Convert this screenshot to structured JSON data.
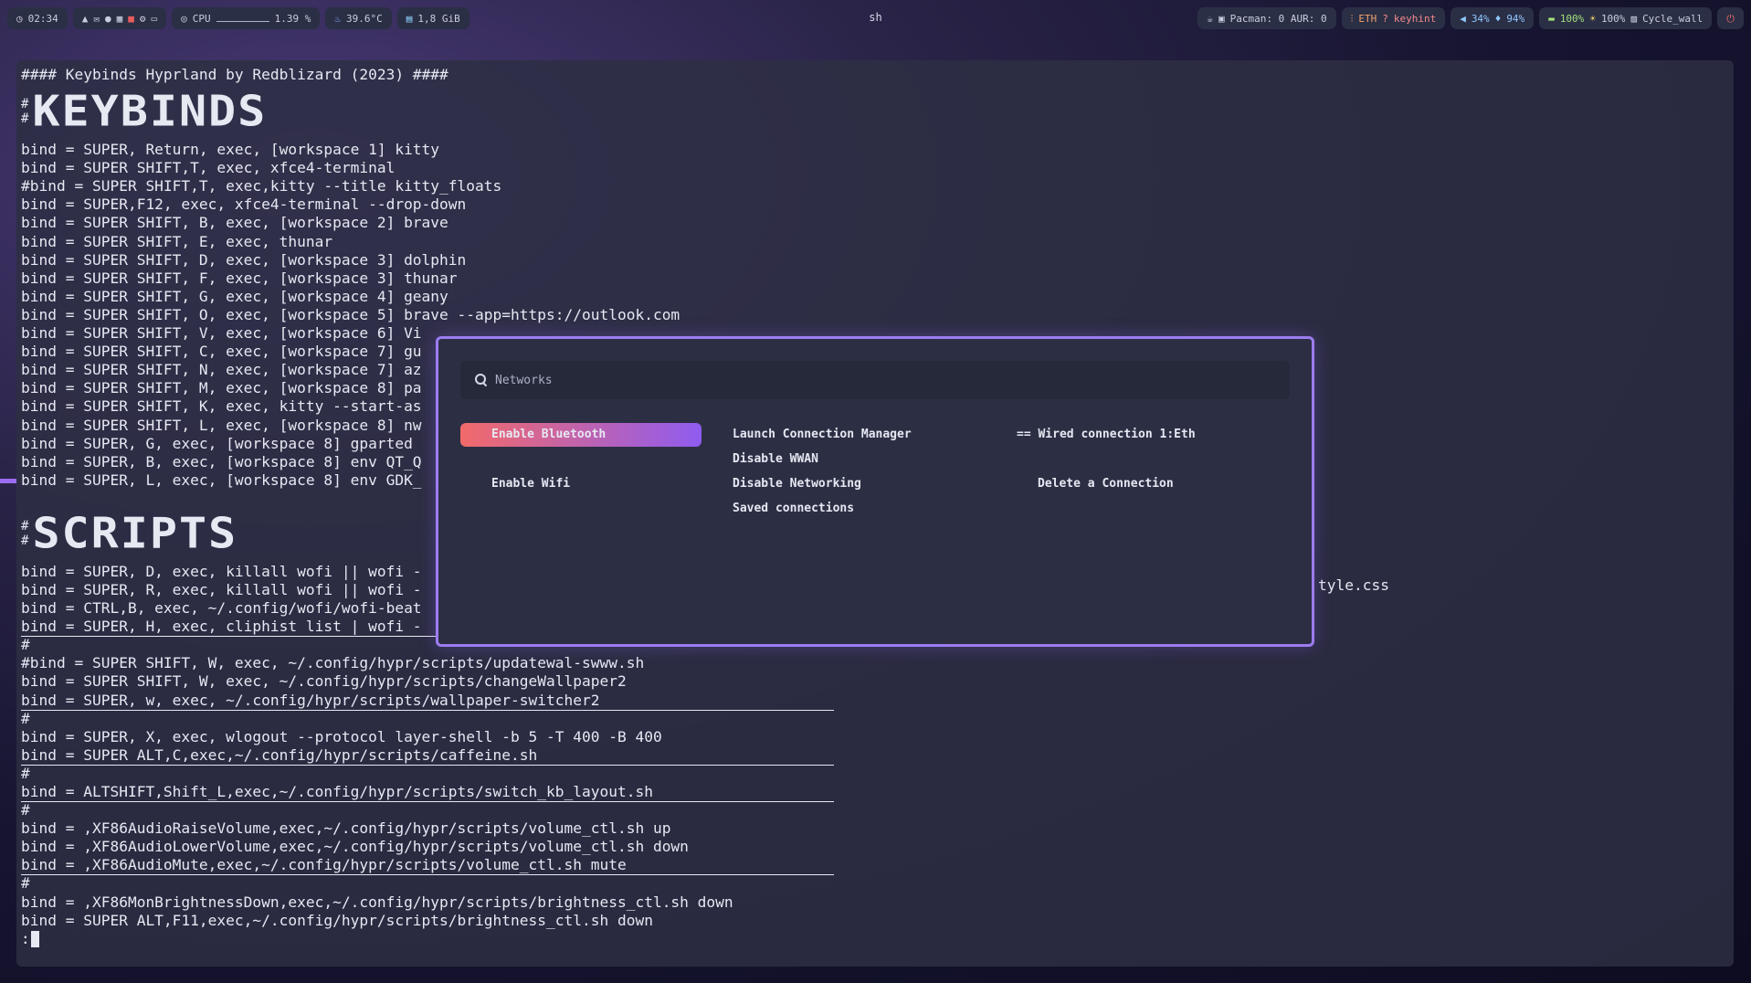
{
  "topbar": {
    "clock": "02:34",
    "cpu_label": "CPU",
    "cpu_value": "1.39 %",
    "temp": "39.6°C",
    "memory": "1,8 GiB",
    "window_title": "sh",
    "updates": "Pacman: 0 AUR: 0",
    "network": "ETH",
    "keyhint": "keyhint",
    "volume": "34%",
    "mic": "94%",
    "battery": "100%",
    "brightness": "100%",
    "wallpaper": "Cycle_wall"
  },
  "terminal": {
    "header": "#### Keybinds Hyprland by Redblizard (2023) ####",
    "section1_title": "KEYBINDS",
    "section2_title": "SCRIPTS",
    "keybind_lines": [
      "bind = SUPER, Return, exec, [workspace 1] kitty",
      "bind = SUPER SHIFT,T, exec, xfce4-terminal",
      "#bind = SUPER SHIFT,T, exec,kitty --title kitty_floats",
      "bind = SUPER,F12, exec, xfce4-terminal --drop-down",
      "bind = SUPER SHIFT, B, exec, [workspace 2] brave",
      "bind = SUPER SHIFT, E, exec, thunar",
      "bind = SUPER SHIFT, D, exec, [workspace 3] dolphin",
      "bind = SUPER SHIFT, F, exec, [workspace 3] thunar",
      "bind = SUPER SHIFT, G, exec, [workspace 4] geany",
      "bind = SUPER SHIFT, O, exec, [workspace 5] brave --app=https://outlook.com",
      "bind = SUPER SHIFT, V, exec, [workspace 6] Vi",
      "bind = SUPER SHIFT, C, exec, [workspace 7] gu",
      "bind = SUPER SHIFT, N, exec, [workspace 7] az",
      "bind = SUPER SHIFT, M, exec, [workspace 8] pa",
      "bind = SUPER SHIFT, K, exec, kitty --start-as",
      "bind = SUPER SHIFT, L, exec, [workspace 8] nw",
      "bind = SUPER, G, exec, [workspace 8] gparted",
      "bind = SUPER, B, exec, [workspace 8] env QT_Q",
      "bind = SUPER, L, exec, [workspace 8] env GDK_"
    ],
    "script_lines_a": [
      "bind = SUPER, D, exec, killall wofi || wofi -",
      "bind = SUPER, R, exec, killall wofi || wofi -",
      "bind = CTRL,B, exec, ~/.config/wofi/wofi-beat",
      "bind = SUPER, H, exec, cliphist list | wofi -"
    ],
    "overflow_fragment": "tyle.css",
    "script_lines_b": [
      "#bind = SUPER SHIFT, W, exec, ~/.config/hypr/scripts/updatewal-swww.sh",
      "bind = SUPER SHIFT, W, exec, ~/.config/hypr/scripts/changeWallpaper2",
      "bind = SUPER, w, exec, ~/.config/hypr/scripts/wallpaper-switcher2"
    ],
    "script_lines_c": [
      "bind = SUPER, X, exec, wlogout --protocol layer-shell -b 5 -T 400 -B 400",
      "bind = SUPER ALT,C,exec,~/.config/hypr/scripts/caffeine.sh"
    ],
    "script_lines_d": [
      "bind = ALTSHIFT,Shift_L,exec,~/.config/hypr/scripts/switch_kb_layout.sh"
    ],
    "script_lines_e": [
      "bind = ,XF86AudioRaiseVolume,exec,~/.config/hypr/scripts/volume_ctl.sh up",
      "bind = ,XF86AudioLowerVolume,exec,~/.config/hypr/scripts/volume_ctl.sh down",
      "bind = ,XF86AudioMute,exec,~/.config/hypr/scripts/volume_ctl.sh mute"
    ],
    "script_lines_f": [
      "bind = ,XF86MonBrightnessDown,exec,~/.config/hypr/scripts/brightness_ctl.sh down",
      "bind = SUPER ALT,F11,exec,~/.config/hypr/scripts/brightness_ctl.sh down"
    ],
    "prompt": ":"
  },
  "dialog": {
    "search_placeholder": "Networks",
    "entries": [
      "Enable Bluetooth",
      "Launch Connection Manager",
      "== Wired connection 1:Eth",
      "Disable WWAN",
      "Enable Wifi",
      "Disable Networking",
      "Delete a Connection",
      "Saved connections"
    ]
  },
  "colors": {
    "accent_border": "#9c7cf0",
    "selected_start": "#f26a6a",
    "selected_end": "#8f5cf0",
    "terminal_bg": "#2d2f44"
  }
}
